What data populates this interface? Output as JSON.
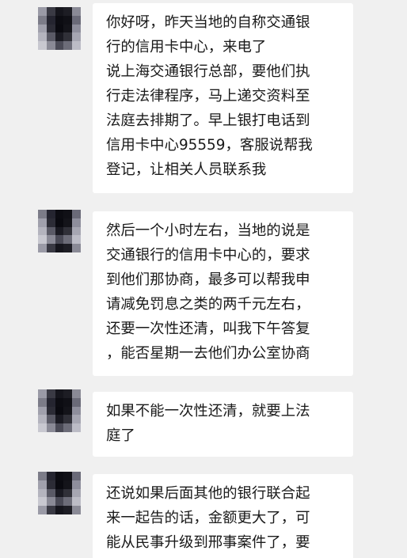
{
  "messages": [
    {
      "lines": [
        "你好呀，昨天当地的自称交通银",
        "行的信用卡中心，来电了",
        "说上海交通银行总部，要他们执",
        "行走法律程序，马上递交资料至",
        "法庭去排期了。早上银打电话到",
        "信用卡中心95559，客服说帮我",
        "登记，让相关人员联系我"
      ]
    },
    {
      "lines": [
        "然后一个小时左右，当地的说是",
        "交通银行的信用卡中心的，要求",
        "到他们那协商，最多可以帮我申",
        "请减免罚息之类的两千元左右，",
        "还要一次性还清，叫我下午答复",
        "，能否星期一去他们办公室协商"
      ]
    },
    {
      "lines": [
        "如果不能一次性还清，就要上法",
        "庭了"
      ]
    },
    {
      "lines": [
        "还说如果后面其他的银行联合起",
        "来一起告的话，金额更大了，可",
        "能从民事升级到邢事案件了，要"
      ]
    }
  ]
}
